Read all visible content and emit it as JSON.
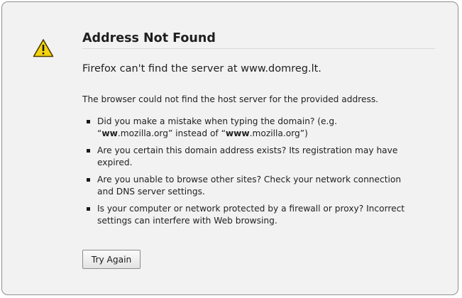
{
  "error": {
    "icon": "warning-icon",
    "title": "Address Not Found",
    "short_desc": "Firefox can't find the server at www.domreg.lt.",
    "long_desc": "The browser could not find the host server for the provided address.",
    "reasons": [
      {
        "part1": "Did you make a mistake when typing the domain? (e.g. “",
        "bold1": "ww",
        "part2": ".mozilla.org” instead of “",
        "bold2": "www",
        "part3": ".mozilla.org”)"
      },
      {
        "text": "Are you certain this domain address exists? Its registration may have expired."
      },
      {
        "text": "Are you unable to browse other sites? Check your network connection and DNS server settings."
      },
      {
        "text": "Is your computer or network protected by a firewall or proxy? Incorrect settings can interfere with Web browsing."
      }
    ],
    "try_again_label": "Try Again"
  },
  "colors": {
    "page_background": "#f2f2f2",
    "border": "#8f8f8f",
    "warning_yellow": "#f5d40f",
    "text": "#1f1f1f"
  }
}
